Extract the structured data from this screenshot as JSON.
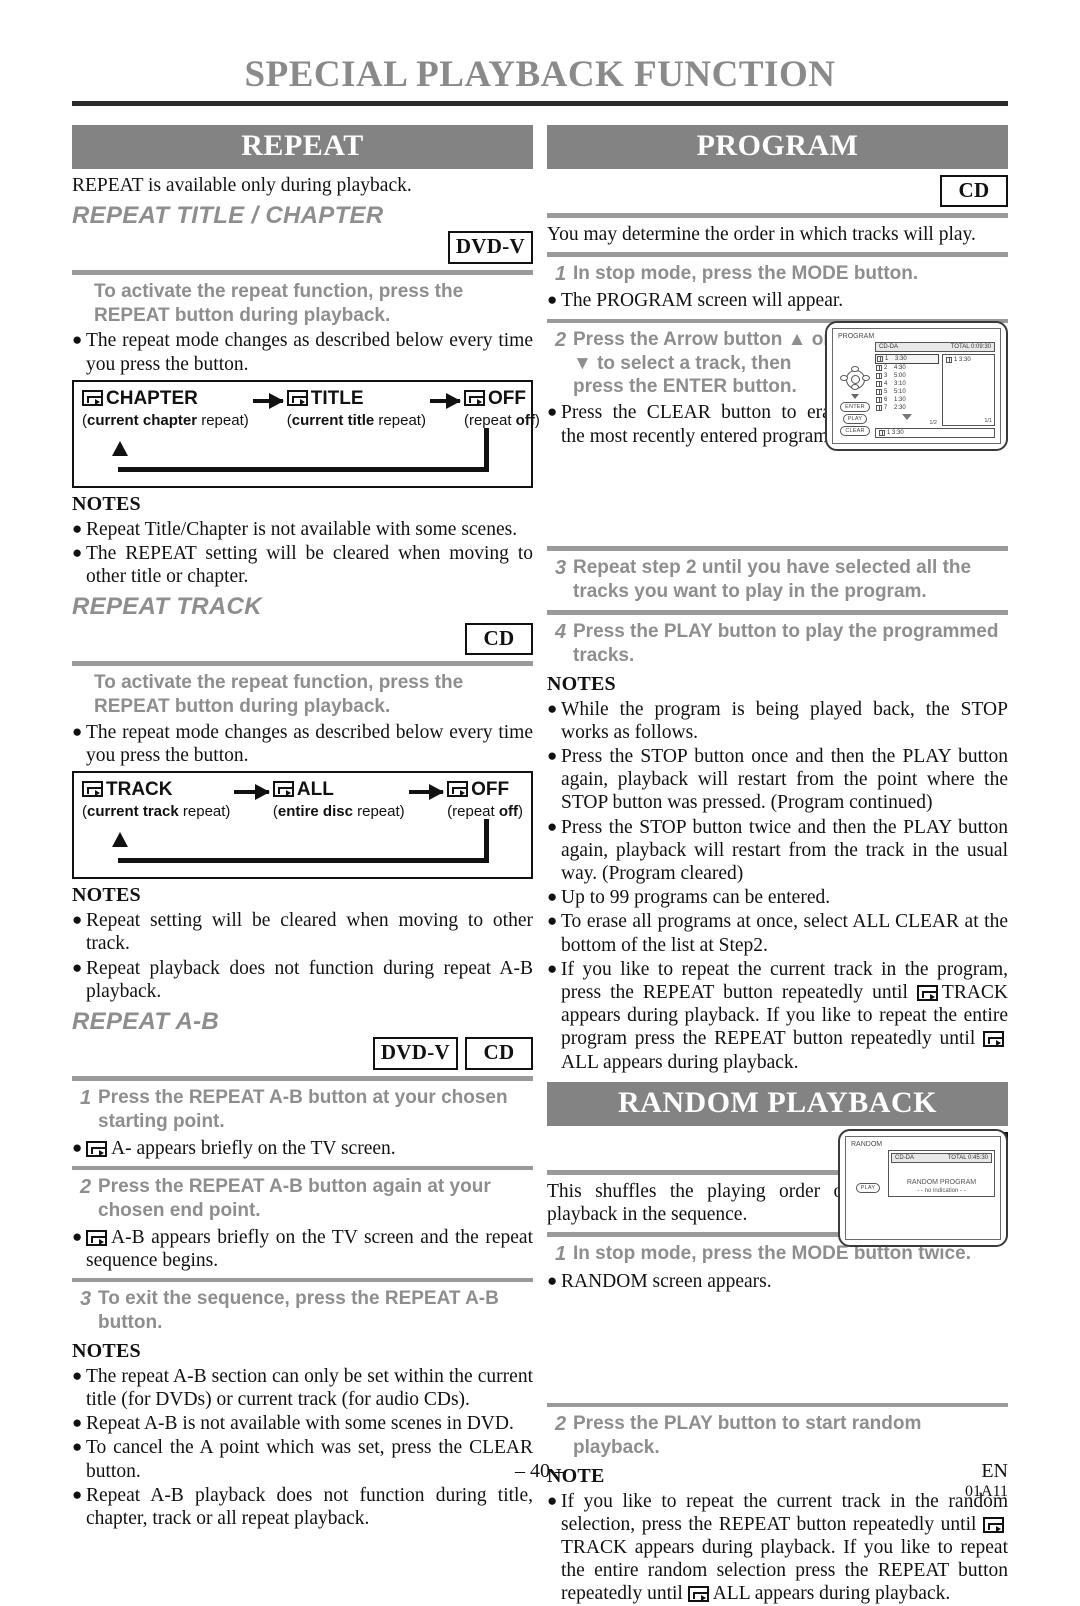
{
  "page": {
    "title": "SPECIAL PLAYBACK FUNCTION",
    "number": "– 40 –",
    "lang": "EN",
    "code": "01A11"
  },
  "badges": {
    "dvd": "DVD-V",
    "cd": "CD"
  },
  "repeat": {
    "banner": "REPEAT",
    "intro": "REPEAT is available only during playback.",
    "title_chapter": {
      "heading": "REPEAT TITLE / CHAPTER",
      "instruction": "To activate the repeat function, press the REPEAT button during playback.",
      "bullet": "The repeat mode changes as described below every time you press the button.",
      "cycle": [
        {
          "label": "CHAPTER",
          "sub_bold": "current chapter",
          "sub_rest": " repeat"
        },
        {
          "label": "TITLE",
          "sub_bold": "current title",
          "sub_rest": " repeat"
        },
        {
          "label": "OFF",
          "sub_pre": "repeat ",
          "sub_bold2": "off"
        }
      ],
      "notes_heading": "NOTES",
      "notes": [
        "Repeat Title/Chapter is not available with some scenes.",
        "The REPEAT setting will be cleared when moving to other title or chapter."
      ]
    },
    "track": {
      "heading": "REPEAT TRACK",
      "instruction": "To activate the repeat function, press the REPEAT button during playback.",
      "bullet": "The repeat mode changes as described below every time you press the button.",
      "cycle": [
        {
          "label": "TRACK",
          "sub_bold": "current track",
          "sub_rest": " repeat"
        },
        {
          "label": "ALL",
          "sub_bold": "entire disc",
          "sub_rest": " repeat"
        },
        {
          "label": "OFF",
          "sub_pre": "repeat ",
          "sub_bold2": "off"
        }
      ],
      "notes_heading": "NOTES",
      "notes": [
        "Repeat setting will be cleared when moving to other track.",
        "Repeat playback does not function during repeat A-B playback."
      ]
    },
    "ab": {
      "heading": "REPEAT A-B",
      "steps": [
        {
          "num": "1",
          "text": "Press the REPEAT A-B button at your chosen starting point."
        },
        {
          "num": "2",
          "text": "Press the REPEAT A-B button again at your chosen end point."
        },
        {
          "num": "3",
          "text": "To exit the sequence, press the REPEAT A-B button."
        }
      ],
      "bullet1": "A- appears briefly on the TV screen.",
      "bullet2": "A-B appears briefly on the TV screen and the repeat sequence begins.",
      "notes_heading": "NOTES",
      "notes": [
        "The repeat A-B section can only be set within the current title (for DVDs) or current track (for audio CDs).",
        "Repeat A-B is not available with some scenes in DVD.",
        "To cancel the A point which was set, press the CLEAR button.",
        "Repeat A-B playback does not function during title, chapter, track or all repeat playback."
      ]
    }
  },
  "program": {
    "banner": "PROGRAM",
    "intro": "You may determine the order in which tracks will play.",
    "steps": [
      {
        "num": "1",
        "text": "In stop mode, press the MODE button."
      },
      {
        "num": "2",
        "text": "Press the Arrow button ▲ or ▼ to select a track, then press the ENTER button."
      },
      {
        "num": "3",
        "text": "Repeat step 2 until you have selected all the tracks you want to play in the program."
      },
      {
        "num": "4",
        "text": "Press the PLAY button to play the programmed tracks."
      }
    ],
    "bullet1": "The PROGRAM screen will appear.",
    "bullet2": "Press the CLEAR button to erase the most recently entered program.",
    "osd": {
      "title": "PROGRAM",
      "disc_type": "CD-DA",
      "total": "TOTAL 0:09:30",
      "tracks": [
        {
          "n": "1",
          "time": "3:30"
        },
        {
          "n": "2",
          "time": "4:30"
        },
        {
          "n": "3",
          "time": "5:00"
        },
        {
          "n": "4",
          "time": "3:10"
        },
        {
          "n": "5",
          "time": "5:10"
        },
        {
          "n": "6",
          "time": "1:30"
        },
        {
          "n": "7",
          "time": "2:30"
        }
      ],
      "program_entry": "1   3:30",
      "footer_entry": "1   3:30",
      "page_left": "1/2",
      "page_right": "1/1",
      "buttons": [
        "ENTER",
        "PLAY",
        "CLEAR"
      ]
    },
    "notes_heading": "NOTES",
    "notes": [
      "While the program is being played back, the STOP works as follows.",
      "Press the STOP button once and then the PLAY button again, playback will restart from the point where the STOP button was pressed. (Program continued)",
      "Press the STOP button twice and then the PLAY button again, playback will restart from the track in the usual way. (Program cleared)",
      "Up to 99 programs can be entered.",
      "To erase all programs at once, select ALL CLEAR at the bottom of the list at Step2."
    ],
    "note_repeat_pre": "If you like to repeat the current track in the program, press the REPEAT button repeatedly until",
    "note_repeat_mid": "TRACK appears during playback. If you like to repeat the entire program press the REPEAT button repeatedly until",
    "note_repeat_end": "ALL appears during playback."
  },
  "random": {
    "banner": "RANDOM PLAYBACK",
    "intro": "This shuffles the playing order of tracks instead of playback in the sequence.",
    "steps": [
      {
        "num": "1",
        "text": "In stop mode, press the MODE button twice."
      },
      {
        "num": "2",
        "text": "Press the PLAY button to start random playback."
      }
    ],
    "bullet1": "RANDOM screen appears.",
    "osd": {
      "title": "RANDOM",
      "disc_type": "CD-DA",
      "total": "TOTAL 0:45:30",
      "center_line1": "RANDOM PROGRAM",
      "center_line2": "- - no indication - -",
      "buttons": [
        "PLAY"
      ]
    },
    "notes_heading": "NOTE",
    "note_repeat_pre": "If you like to repeat the current track in the random selection, press the REPEAT button repeatedly until",
    "note_repeat_mid": "TRACK appears during playback. If you like to repeat the entire random selection press the REPEAT button repeatedly until",
    "note_repeat_end": "ALL appears during playback."
  }
}
